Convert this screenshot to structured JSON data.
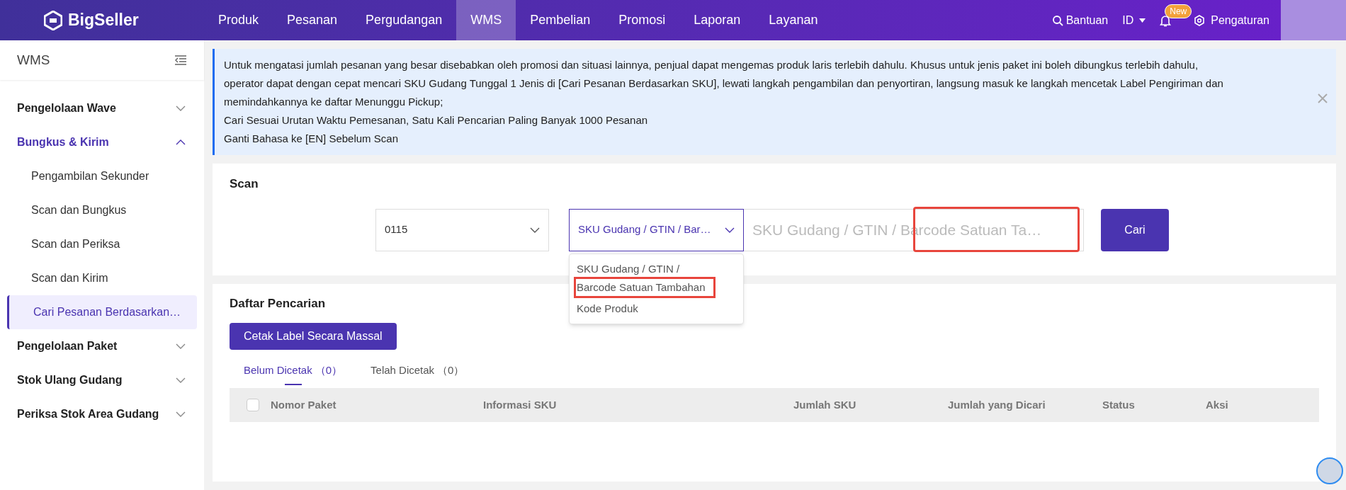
{
  "topbar": {
    "logo": "BigSeller",
    "nav": [
      {
        "label": "Produk",
        "selected": false
      },
      {
        "label": "Pesanan",
        "selected": false
      },
      {
        "label": "Pergudangan",
        "selected": false
      },
      {
        "label": "WMS",
        "selected": true
      },
      {
        "label": "Pembelian",
        "selected": false
      },
      {
        "label": "Promosi",
        "selected": false
      },
      {
        "label": "Laporan",
        "selected": false
      },
      {
        "label": "Layanan",
        "selected": false
      }
    ],
    "help": "Bantuan",
    "language": "ID",
    "notification_badge": "New",
    "settings": "Pengaturan"
  },
  "sidebar": {
    "title": "WMS",
    "groups": [
      {
        "label": "Pengelolaan Wave",
        "expanded": false
      },
      {
        "label": "Bungkus & Kirim",
        "expanded": true,
        "children": [
          {
            "label": "Pengambilan Sekunder",
            "selected": false
          },
          {
            "label": "Scan dan Bungkus",
            "selected": false
          },
          {
            "label": "Scan dan Periksa",
            "selected": false
          },
          {
            "label": "Scan dan Kirim",
            "selected": false
          },
          {
            "label": "Cari Pesanan Berdasarkan…",
            "selected": true
          }
        ]
      },
      {
        "label": "Pengelolaan Paket",
        "expanded": false
      },
      {
        "label": "Stok Ulang Gudang",
        "expanded": false
      },
      {
        "label": "Periksa Stok Area Gudang",
        "expanded": false
      }
    ]
  },
  "notice": {
    "lines": [
      "Untuk mengatasi jumlah pesanan yang besar disebabkan oleh promosi dan situasi lainnya, penjual dapat mengemas produk laris terlebih dahulu. Khusus untuk jenis paket ini boleh dibungkus terlebih dahulu, operator dapat dengan cepat mencari SKU Gudang Tunggal 1 Jenis di [Cari Pesanan Berdasarkan SKU], lewati langkah pengambilan dan penyortiran, langsung masuk ke langkah mencetak Label Pengiriman dan memindahkannya ke daftar Menunggu Pickup;",
      "Cari Sesuai Urutan Waktu Pemesanan, Satu Kali Pencarian Paling Banyak 1000 Pesanan",
      "Ganti Bahasa ke [EN] Sebelum Scan"
    ]
  },
  "scan": {
    "title": "Scan",
    "warehouse_select": "0115",
    "type_select": "SKU Gudang / GTIN / Bar…",
    "input": {
      "placeholder": "SKU Gudang / GTIN / Barcode Satuan Ta…",
      "highlighted": true
    },
    "search_button": "Cari",
    "dropdown": [
      {
        "lines": [
          {
            "text": "SKU Gudang / GTIN /",
            "highlighted": false
          },
          {
            "text": "Barcode Satuan Tambahan",
            "highlighted": true
          }
        ]
      },
      {
        "lines": [
          {
            "text": "Kode Produk",
            "highlighted": false
          }
        ]
      }
    ]
  },
  "results": {
    "title": "Daftar Pencarian",
    "bulk_button": "Cetak Label Secara Massal",
    "tabs": [
      {
        "label": "Belum Dicetak",
        "count": "（0）",
        "selected": true
      },
      {
        "label": "Telah Dicetak",
        "count": "（0）",
        "selected": false
      }
    ],
    "select_all": {
      "checked": false
    },
    "columns": [
      "Nomor Paket",
      "Informasi SKU",
      "Jumlah SKU",
      "Jumlah yang Dicari",
      "Status",
      "Aksi"
    ]
  }
}
